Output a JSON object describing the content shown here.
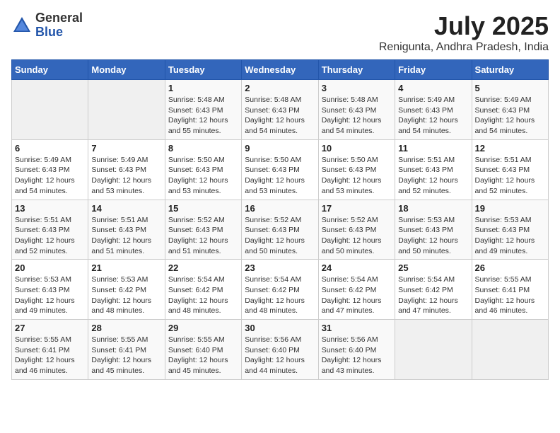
{
  "logo": {
    "general": "General",
    "blue": "Blue"
  },
  "header": {
    "month_year": "July 2025",
    "location": "Renigunta, Andhra Pradesh, India"
  },
  "weekdays": [
    "Sunday",
    "Monday",
    "Tuesday",
    "Wednesday",
    "Thursday",
    "Friday",
    "Saturday"
  ],
  "weeks": [
    [
      {
        "day": "",
        "sunrise": "",
        "sunset": "",
        "daylight": ""
      },
      {
        "day": "",
        "sunrise": "",
        "sunset": "",
        "daylight": ""
      },
      {
        "day": "1",
        "sunrise": "Sunrise: 5:48 AM",
        "sunset": "Sunset: 6:43 PM",
        "daylight": "Daylight: 12 hours and 55 minutes."
      },
      {
        "day": "2",
        "sunrise": "Sunrise: 5:48 AM",
        "sunset": "Sunset: 6:43 PM",
        "daylight": "Daylight: 12 hours and 54 minutes."
      },
      {
        "day": "3",
        "sunrise": "Sunrise: 5:48 AM",
        "sunset": "Sunset: 6:43 PM",
        "daylight": "Daylight: 12 hours and 54 minutes."
      },
      {
        "day": "4",
        "sunrise": "Sunrise: 5:49 AM",
        "sunset": "Sunset: 6:43 PM",
        "daylight": "Daylight: 12 hours and 54 minutes."
      },
      {
        "day": "5",
        "sunrise": "Sunrise: 5:49 AM",
        "sunset": "Sunset: 6:43 PM",
        "daylight": "Daylight: 12 hours and 54 minutes."
      }
    ],
    [
      {
        "day": "6",
        "sunrise": "Sunrise: 5:49 AM",
        "sunset": "Sunset: 6:43 PM",
        "daylight": "Daylight: 12 hours and 54 minutes."
      },
      {
        "day": "7",
        "sunrise": "Sunrise: 5:49 AM",
        "sunset": "Sunset: 6:43 PM",
        "daylight": "Daylight: 12 hours and 53 minutes."
      },
      {
        "day": "8",
        "sunrise": "Sunrise: 5:50 AM",
        "sunset": "Sunset: 6:43 PM",
        "daylight": "Daylight: 12 hours and 53 minutes."
      },
      {
        "day": "9",
        "sunrise": "Sunrise: 5:50 AM",
        "sunset": "Sunset: 6:43 PM",
        "daylight": "Daylight: 12 hours and 53 minutes."
      },
      {
        "day": "10",
        "sunrise": "Sunrise: 5:50 AM",
        "sunset": "Sunset: 6:43 PM",
        "daylight": "Daylight: 12 hours and 53 minutes."
      },
      {
        "day": "11",
        "sunrise": "Sunrise: 5:51 AM",
        "sunset": "Sunset: 6:43 PM",
        "daylight": "Daylight: 12 hours and 52 minutes."
      },
      {
        "day": "12",
        "sunrise": "Sunrise: 5:51 AM",
        "sunset": "Sunset: 6:43 PM",
        "daylight": "Daylight: 12 hours and 52 minutes."
      }
    ],
    [
      {
        "day": "13",
        "sunrise": "Sunrise: 5:51 AM",
        "sunset": "Sunset: 6:43 PM",
        "daylight": "Daylight: 12 hours and 52 minutes."
      },
      {
        "day": "14",
        "sunrise": "Sunrise: 5:51 AM",
        "sunset": "Sunset: 6:43 PM",
        "daylight": "Daylight: 12 hours and 51 minutes."
      },
      {
        "day": "15",
        "sunrise": "Sunrise: 5:52 AM",
        "sunset": "Sunset: 6:43 PM",
        "daylight": "Daylight: 12 hours and 51 minutes."
      },
      {
        "day": "16",
        "sunrise": "Sunrise: 5:52 AM",
        "sunset": "Sunset: 6:43 PM",
        "daylight": "Daylight: 12 hours and 50 minutes."
      },
      {
        "day": "17",
        "sunrise": "Sunrise: 5:52 AM",
        "sunset": "Sunset: 6:43 PM",
        "daylight": "Daylight: 12 hours and 50 minutes."
      },
      {
        "day": "18",
        "sunrise": "Sunrise: 5:53 AM",
        "sunset": "Sunset: 6:43 PM",
        "daylight": "Daylight: 12 hours and 50 minutes."
      },
      {
        "day": "19",
        "sunrise": "Sunrise: 5:53 AM",
        "sunset": "Sunset: 6:43 PM",
        "daylight": "Daylight: 12 hours and 49 minutes."
      }
    ],
    [
      {
        "day": "20",
        "sunrise": "Sunrise: 5:53 AM",
        "sunset": "Sunset: 6:43 PM",
        "daylight": "Daylight: 12 hours and 49 minutes."
      },
      {
        "day": "21",
        "sunrise": "Sunrise: 5:53 AM",
        "sunset": "Sunset: 6:42 PM",
        "daylight": "Daylight: 12 hours and 48 minutes."
      },
      {
        "day": "22",
        "sunrise": "Sunrise: 5:54 AM",
        "sunset": "Sunset: 6:42 PM",
        "daylight": "Daylight: 12 hours and 48 minutes."
      },
      {
        "day": "23",
        "sunrise": "Sunrise: 5:54 AM",
        "sunset": "Sunset: 6:42 PM",
        "daylight": "Daylight: 12 hours and 48 minutes."
      },
      {
        "day": "24",
        "sunrise": "Sunrise: 5:54 AM",
        "sunset": "Sunset: 6:42 PM",
        "daylight": "Daylight: 12 hours and 47 minutes."
      },
      {
        "day": "25",
        "sunrise": "Sunrise: 5:54 AM",
        "sunset": "Sunset: 6:42 PM",
        "daylight": "Daylight: 12 hours and 47 minutes."
      },
      {
        "day": "26",
        "sunrise": "Sunrise: 5:55 AM",
        "sunset": "Sunset: 6:41 PM",
        "daylight": "Daylight: 12 hours and 46 minutes."
      }
    ],
    [
      {
        "day": "27",
        "sunrise": "Sunrise: 5:55 AM",
        "sunset": "Sunset: 6:41 PM",
        "daylight": "Daylight: 12 hours and 46 minutes."
      },
      {
        "day": "28",
        "sunrise": "Sunrise: 5:55 AM",
        "sunset": "Sunset: 6:41 PM",
        "daylight": "Daylight: 12 hours and 45 minutes."
      },
      {
        "day": "29",
        "sunrise": "Sunrise: 5:55 AM",
        "sunset": "Sunset: 6:40 PM",
        "daylight": "Daylight: 12 hours and 45 minutes."
      },
      {
        "day": "30",
        "sunrise": "Sunrise: 5:56 AM",
        "sunset": "Sunset: 6:40 PM",
        "daylight": "Daylight: 12 hours and 44 minutes."
      },
      {
        "day": "31",
        "sunrise": "Sunrise: 5:56 AM",
        "sunset": "Sunset: 6:40 PM",
        "daylight": "Daylight: 12 hours and 43 minutes."
      },
      {
        "day": "",
        "sunrise": "",
        "sunset": "",
        "daylight": ""
      },
      {
        "day": "",
        "sunrise": "",
        "sunset": "",
        "daylight": ""
      }
    ]
  ]
}
